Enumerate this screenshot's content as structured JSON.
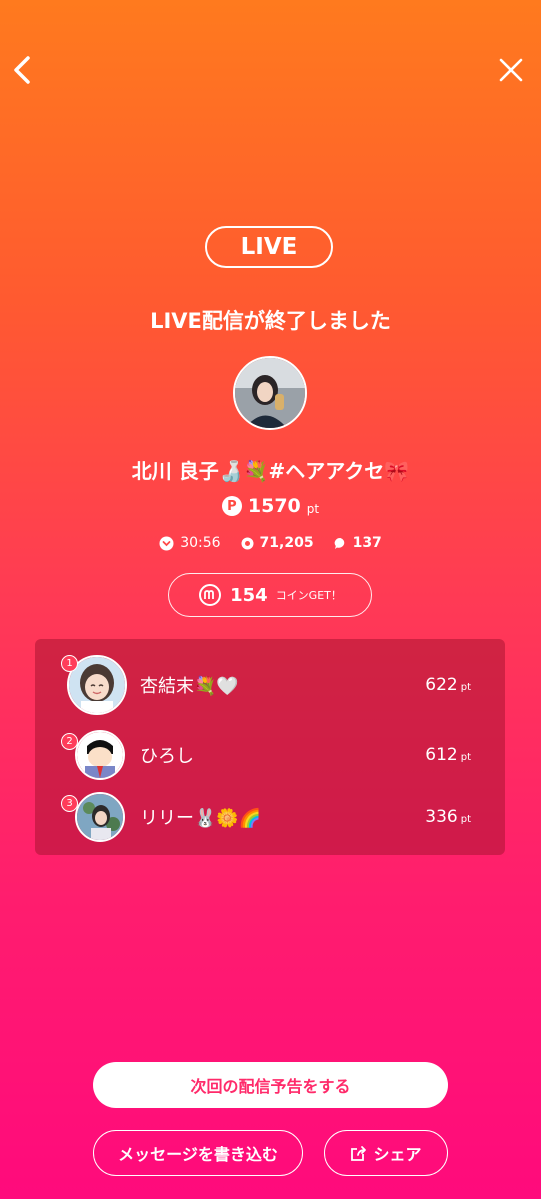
{
  "header": {
    "back_icon": "chevron-left-icon",
    "close_icon": "close-icon"
  },
  "live_badge": "LIVE",
  "ended_message": "LIVE配信が終了しました",
  "streamer": {
    "name": "北川 良子🍶💐#ヘアアクセ🎀",
    "points": "1570",
    "points_unit": "pt"
  },
  "stats": {
    "duration": "30:56",
    "viewers": "71,205",
    "comments": "137"
  },
  "coins": {
    "amount": "154",
    "label": "コインGET！"
  },
  "ranking": [
    {
      "rank": "1",
      "name": "杏結末💐🤍",
      "points": "622",
      "unit": "pt"
    },
    {
      "rank": "2",
      "name": "ひろし",
      "points": "612",
      "unit": "pt"
    },
    {
      "rank": "3",
      "name": "リリー🐰🌼🌈",
      "points": "336",
      "unit": "pt"
    }
  ],
  "buttons": {
    "schedule": "次回の配信予告をする",
    "message": "メッセージを書き込む",
    "share": "シェア"
  }
}
